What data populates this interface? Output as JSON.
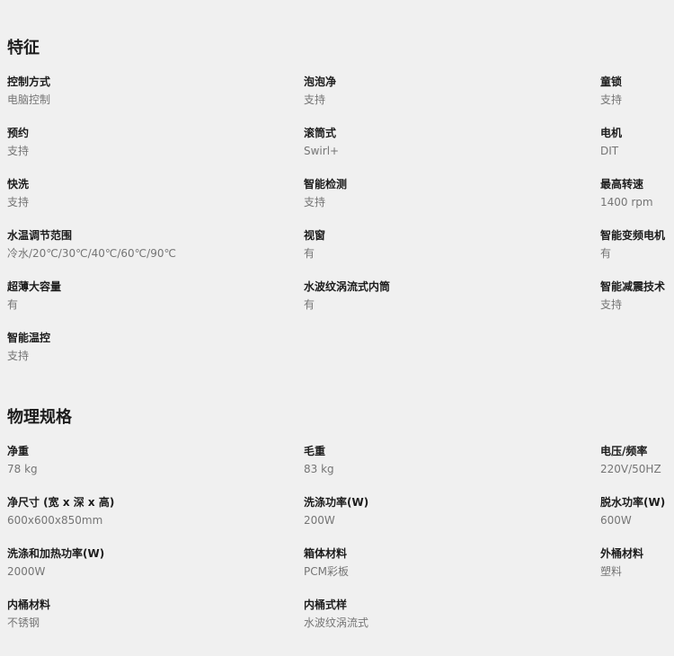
{
  "sections": [
    {
      "title": "特征",
      "specs": [
        {
          "label": "控制方式",
          "value": "电脑控制"
        },
        {
          "label": "泡泡净",
          "value": "支持"
        },
        {
          "label": "童锁",
          "value": "支持"
        },
        {
          "label": "预约",
          "value": "支持"
        },
        {
          "label": "滚筒式",
          "value": "Swirl+"
        },
        {
          "label": "电机",
          "value": "DIT"
        },
        {
          "label": "快洗",
          "value": "支持"
        },
        {
          "label": "智能检测",
          "value": "支持"
        },
        {
          "label": "最高转速",
          "value": "1400 rpm"
        },
        {
          "label": "水温调节范围",
          "value": "冷水/20℃/30℃/40℃/60℃/90℃"
        },
        {
          "label": "视窗",
          "value": "有"
        },
        {
          "label": "智能变频电机",
          "value": "有"
        },
        {
          "label": "超薄大容量",
          "value": "有"
        },
        {
          "label": "水波纹涡流式内筒",
          "value": "有"
        },
        {
          "label": "智能减震技术",
          "value": "支持"
        },
        {
          "label": "智能温控",
          "value": "支持"
        }
      ]
    },
    {
      "title": "物理规格",
      "specs": [
        {
          "label": "净重",
          "value": "78 kg"
        },
        {
          "label": "毛重",
          "value": "83 kg"
        },
        {
          "label": "电压/频率",
          "value": "220V/50HZ"
        },
        {
          "label": "净尺寸 (宽 x 深 x 高)",
          "value": "600x600x850mm"
        },
        {
          "label": "洗涤功率(W)",
          "value": "200W"
        },
        {
          "label": "脱水功率(W)",
          "value": "600W"
        },
        {
          "label": "洗涤和加热功率(W)",
          "value": "2000W"
        },
        {
          "label": "箱体材料",
          "value": "PCM彩板"
        },
        {
          "label": "外桶材料",
          "value": "塑料"
        },
        {
          "label": "内桶材料",
          "value": "不锈钢"
        },
        {
          "label": "内桶式样",
          "value": "水波纹涡流式"
        }
      ]
    }
  ]
}
